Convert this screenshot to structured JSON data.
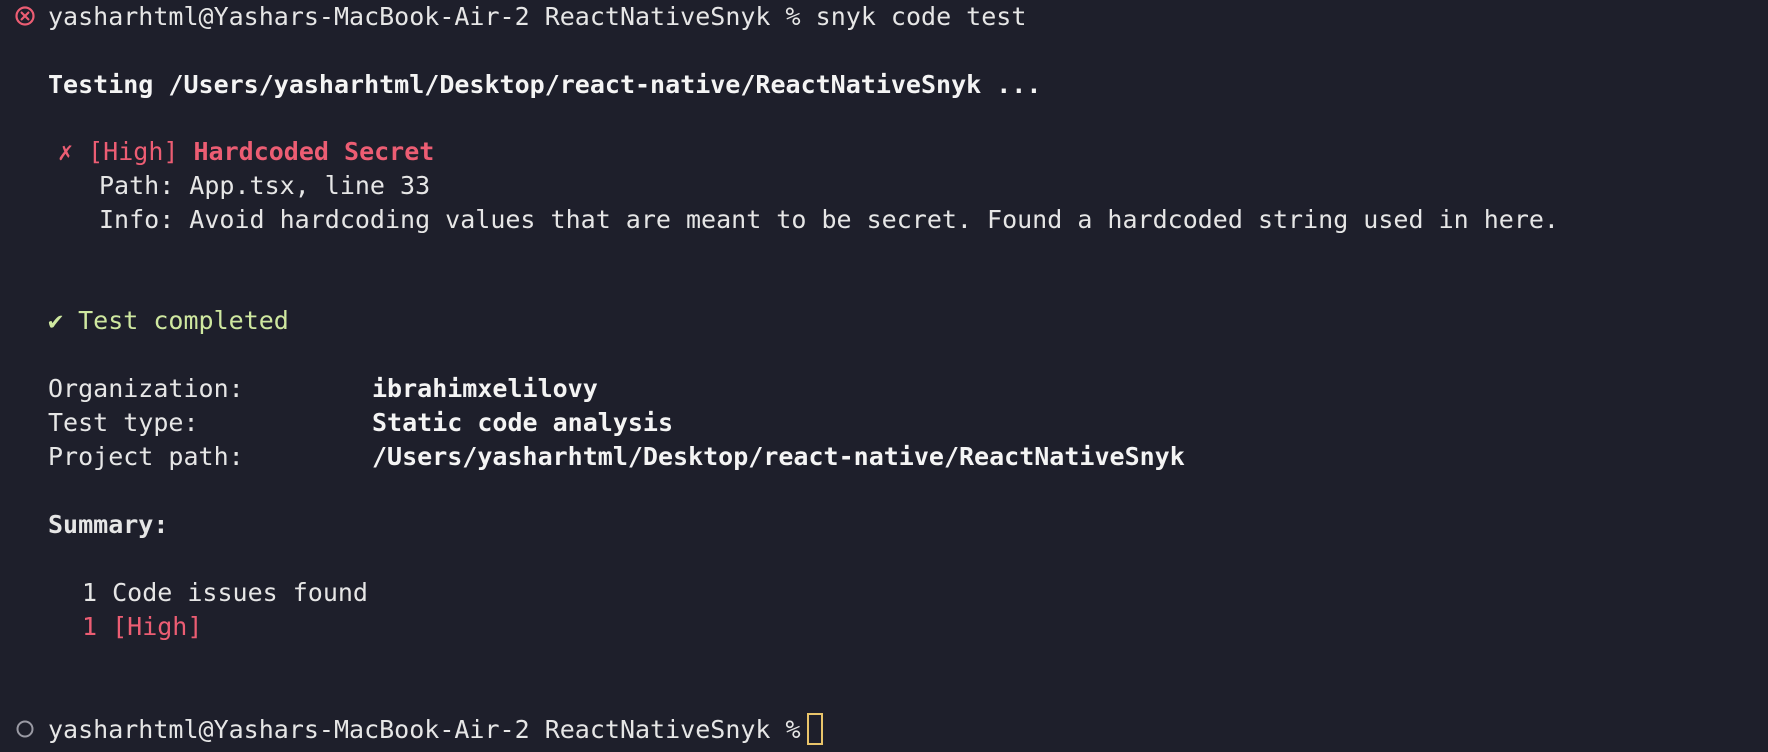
{
  "prompt": {
    "user_host": "yasharhtml@Yashars-MacBook-Air-2",
    "directory": "ReactNativeSnyk",
    "symbol": "%",
    "command": "snyk code test"
  },
  "testing_line": "Testing /Users/yasharhtml/Desktop/react-native/ReactNativeSnyk ...",
  "issue": {
    "mark": "✗",
    "severity": "[High]",
    "title": "Hardcoded Secret",
    "path": "Path: App.tsx, line 33",
    "info": "Info: Avoid hardcoding values that are meant to be secret. Found a hardcoded string used in here."
  },
  "completed": {
    "check": "✔",
    "text": "Test completed"
  },
  "details": {
    "organization_label": "Organization:",
    "organization_value": "ibrahimxelilovy",
    "test_type_label": "Test type:",
    "test_type_value": "Static code analysis",
    "project_path_label": "Project path:",
    "project_path_value": "/Users/yasharhtml/Desktop/react-native/ReactNativeSnyk"
  },
  "summary": {
    "heading": "Summary:",
    "issues_found": "1 Code issues found",
    "high_count": "1 [High]"
  },
  "colors": {
    "background": "#1e1f2b",
    "error_red": "#ec5d73",
    "success_green": "#cfe8a0",
    "cursor_yellow": "#e9c46a"
  },
  "icons": {
    "first_prompt_status": "error-circle-icon",
    "second_prompt_status": "idle-circle-icon"
  }
}
